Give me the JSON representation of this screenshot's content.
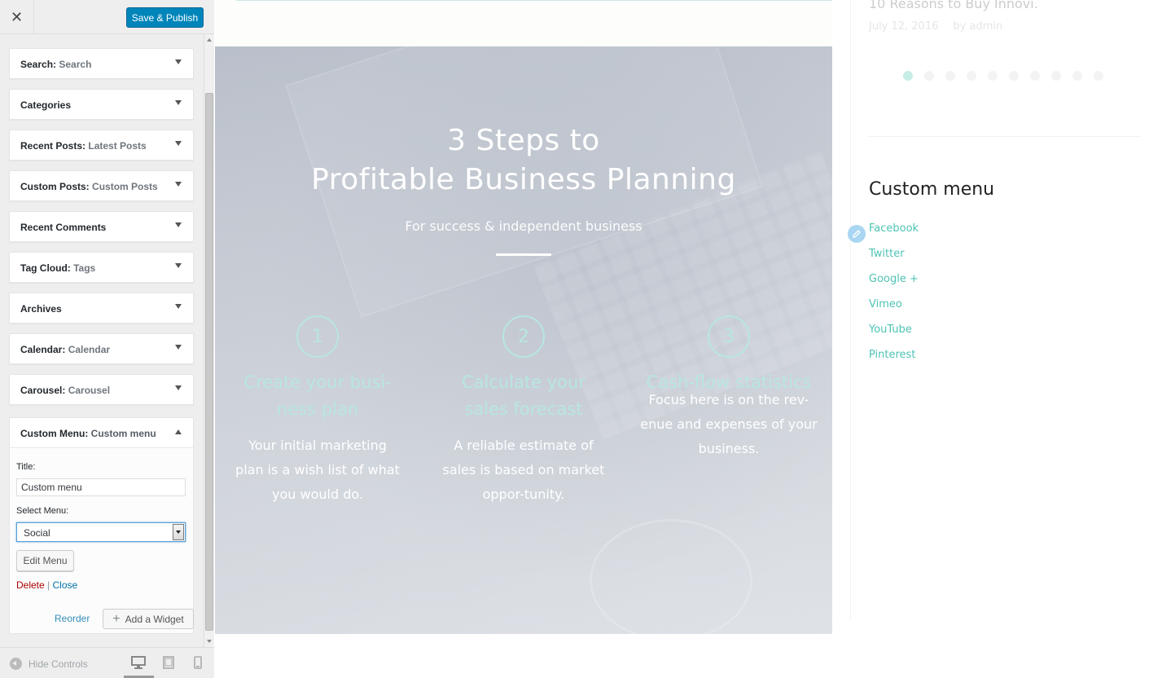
{
  "panel": {
    "close_icon": "close-icon",
    "save_label": "Save & Publish",
    "widgets": [
      {
        "name": "Search:",
        "sub": "Search"
      },
      {
        "name": "Categories",
        "sub": ""
      },
      {
        "name": "Recent Posts:",
        "sub": "Latest Posts"
      },
      {
        "name": "Custom Posts:",
        "sub": "Custom Posts"
      },
      {
        "name": "Recent Comments",
        "sub": ""
      },
      {
        "name": "Tag Cloud:",
        "sub": "Tags"
      },
      {
        "name": "Archives",
        "sub": ""
      },
      {
        "name": "Calendar:",
        "sub": "Calendar"
      },
      {
        "name": "Carousel:",
        "sub": "Carousel"
      }
    ],
    "custom_menu_widget": {
      "name": "Custom Menu:",
      "sub": "Custom menu",
      "title_label": "Title:",
      "title_value": "Custom menu",
      "select_label": "Select Menu:",
      "select_value": "Social",
      "edit_menu_label": "Edit Menu",
      "delete_label": "Delete",
      "separator": "|",
      "close_label": "Close"
    },
    "reorder_label": "Reorder",
    "add_widget_label": "Add a Widget",
    "hide_controls_label": "Hide Controls"
  },
  "hero": {
    "title_line1": "3 Steps to",
    "title_line2": "Profitable Business Planning",
    "subtitle": "For success & independent business",
    "steps": [
      {
        "num": "1",
        "title": "Create your busi-ness plan",
        "text": "Your initial marketing plan is a wish list of what you would do."
      },
      {
        "num": "2",
        "title": "Calculate your sales forecast",
        "text": "A reliable estimate of sales is based on market oppor-tunity."
      },
      {
        "num": "3",
        "title": "Cash-flow statistics",
        "text": "Focus here is on the rev-enue and expenses of your business."
      }
    ]
  },
  "sidebar": {
    "post_title": "10 Reasons to Buy Innovi.",
    "post_date": "July 12, 2016",
    "post_author": "by admin",
    "dot_count": 10,
    "active_dot": 0,
    "custom_menu_title": "Custom menu",
    "menu_items": [
      "Facebook",
      "Twitter",
      "Google +",
      "Vimeo",
      "YouTube",
      "Pinterest"
    ]
  },
  "colors": {
    "accent": "#0085ba",
    "teal": "#4ec3b4",
    "delete_red": "#aa0000"
  }
}
